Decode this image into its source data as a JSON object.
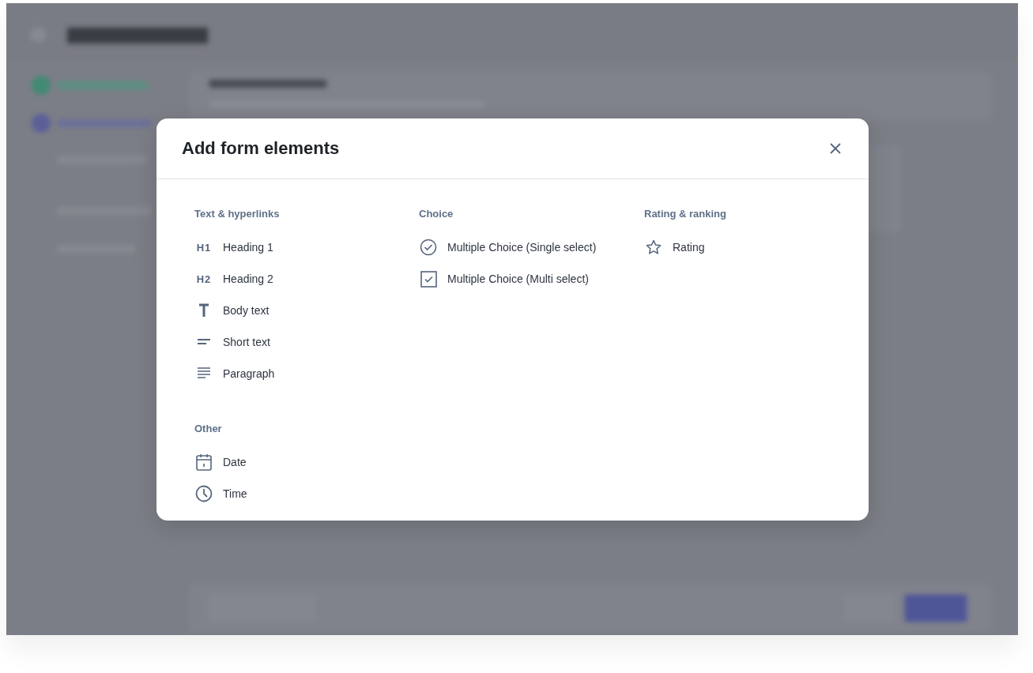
{
  "dialog": {
    "title": "Add form elements",
    "columns": [
      {
        "sections": [
          {
            "heading": "Text & hyperlinks",
            "items": [
              {
                "kind": "h1",
                "icon_text": "H1",
                "label": "Heading 1"
              },
              {
                "kind": "h2",
                "icon_text": "H2",
                "label": "Heading 2"
              },
              {
                "kind": "body",
                "label": "Body text"
              },
              {
                "kind": "short",
                "label": "Short text"
              },
              {
                "kind": "paragraph",
                "label": "Paragraph"
              }
            ]
          },
          {
            "heading": "Other",
            "items": [
              {
                "kind": "date",
                "label": "Date"
              },
              {
                "kind": "time",
                "label": "Time"
              }
            ]
          }
        ]
      },
      {
        "sections": [
          {
            "heading": "Choice",
            "items": [
              {
                "kind": "single",
                "label": "Multiple Choice (Single select)"
              },
              {
                "kind": "multi",
                "label": "Multiple Choice (Multi select)"
              }
            ]
          }
        ]
      },
      {
        "sections": [
          {
            "heading": "Rating & ranking",
            "items": [
              {
                "kind": "rating",
                "label": "Rating"
              }
            ]
          }
        ]
      }
    ]
  }
}
